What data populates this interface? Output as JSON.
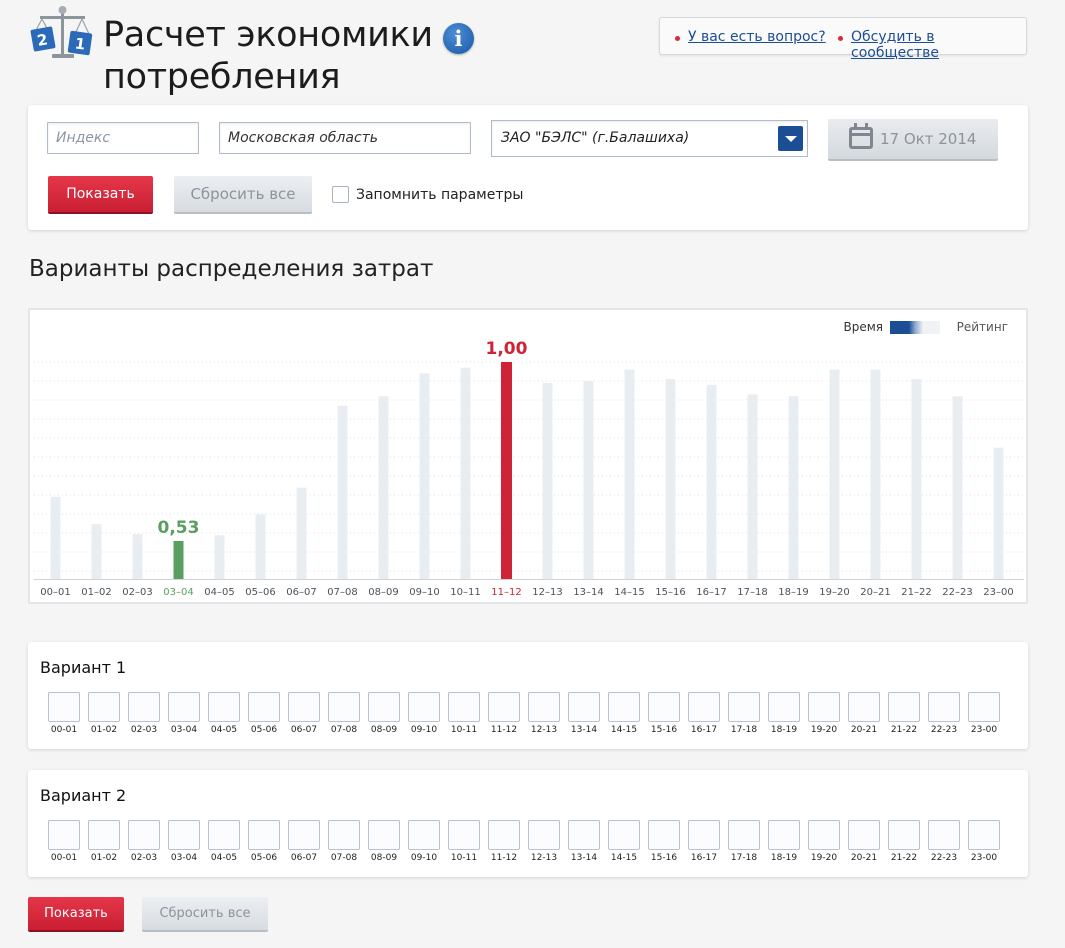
{
  "header": {
    "title_line1": "Расчет экономики",
    "title_line2": "потребления",
    "info_icon": "info-icon",
    "logo": "scales-icon",
    "links": [
      "У вас есть вопрос?",
      "Обсудить в сообществе"
    ]
  },
  "filters": {
    "index_placeholder": "Индекс",
    "region_value": "Московская область",
    "supplier_value": "ЗАО \"БЭЛС\" (г.Балашиха)",
    "date_label": "17 Окт 2014",
    "show_label": "Показать",
    "reset_label": "Сбросить все",
    "remember_label": "Запомнить параметры"
  },
  "section_title": "Варианты распределения затрат",
  "legend": {
    "left": "Время",
    "right": "Рейтинг"
  },
  "chart_data": {
    "type": "bar",
    "categories": [
      "00–01",
      "01–02",
      "02–03",
      "03–04",
      "04–05",
      "05–06",
      "06–07",
      "07–08",
      "08–09",
      "09–10",
      "10–11",
      "11–12",
      "12–13",
      "13–14",
      "14–15",
      "15–16",
      "16–17",
      "17–18",
      "18–19",
      "19–20",
      "20–21",
      "21–22",
      "22–23",
      "23–00"
    ],
    "values": [
      0.646,
      0.574,
      0.548,
      0.53,
      0.545,
      0.6,
      0.67,
      0.885,
      0.91,
      0.97,
      0.985,
      1.0,
      0.945,
      0.95,
      0.98,
      0.955,
      0.94,
      0.915,
      0.91,
      0.98,
      0.98,
      0.955,
      0.91,
      0.775
    ],
    "ylim": [
      0.43,
      1.0
    ],
    "min_label": "0,53",
    "max_label": "1,00",
    "min_index": 3,
    "max_index": 11,
    "colors": {
      "bar": "#e8edf2",
      "min": "#5a9e62",
      "max": "#cf2338",
      "grid": "#dcdfe3",
      "label": "#4d5259"
    }
  },
  "variants": [
    {
      "title": "Вариант 1"
    },
    {
      "title": "Вариант 2"
    }
  ],
  "slot_labels": [
    "00-01",
    "01-02",
    "02-03",
    "03-04",
    "04-05",
    "05-06",
    "06-07",
    "07-08",
    "08-09",
    "09-10",
    "10-11",
    "11-12",
    "12-13",
    "13-14",
    "14-15",
    "15-16",
    "16-17",
    "17-18",
    "18-19",
    "19-20",
    "20-21",
    "21-22",
    "22-23",
    "23-00"
  ],
  "bottom": {
    "show_label": "Показать",
    "reset_label": "Сбросить все"
  }
}
